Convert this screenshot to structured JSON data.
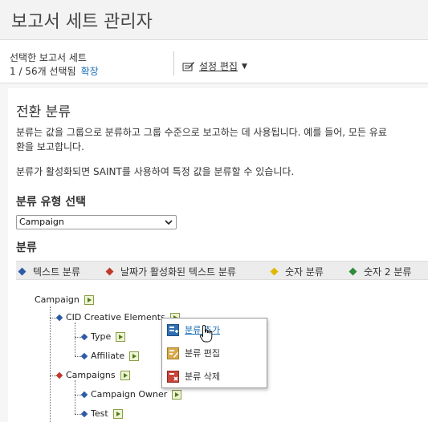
{
  "page": {
    "title": "보고서 세트 관리자"
  },
  "selection": {
    "label": "선택한 보고서 세트",
    "count_text": "1 / 56개 선택됨",
    "expand_link": "확장",
    "settings_label": "설정 편집"
  },
  "section": {
    "title": "전환 분류",
    "desc_line1": "분류는 값을 그룹으로 분류하고 그룹 수준으로 보고하는 데 사용됩니다. 예를 들어, 모든 유료",
    "desc_line2": "환을 보고합니다.",
    "desc2": "분류가 활성화되면 SAINT를 사용하여 특정 값을 분류할 수 있습니다.",
    "type_heading": "분류 유형 선택",
    "type_select_value": "Campaign",
    "classification_heading": "분류"
  },
  "legend": [
    {
      "label": "텍스트 분류",
      "color": "#2e5aa6"
    },
    {
      "label": "날짜가 활성화된 텍스트 분류",
      "color": "#c0392b"
    },
    {
      "label": "숫자 분류",
      "color": "#e0b800"
    },
    {
      "label": "숫자 2 분류",
      "color": "#2e8b3a"
    }
  ],
  "tree": {
    "root": "Campaign",
    "nodes": [
      {
        "label": "CID Creative Elements",
        "color": "#2e5aa6"
      },
      {
        "label": "Type",
        "color": "#2e5aa6"
      },
      {
        "label": "Affiliate",
        "color": "#2e5aa6"
      },
      {
        "label": "Campaigns",
        "color": "#c0392b"
      },
      {
        "label": "Campaign Owner",
        "color": "#2e5aa6"
      },
      {
        "label": "Test",
        "color": "#2e5aa6"
      }
    ]
  },
  "context_menu": {
    "items": [
      {
        "label": "분류 추가",
        "icon": "add-classification-icon"
      },
      {
        "label": "분류 편집",
        "icon": "edit-classification-icon"
      },
      {
        "label": "분류 삭제",
        "icon": "delete-classification-icon"
      }
    ]
  }
}
